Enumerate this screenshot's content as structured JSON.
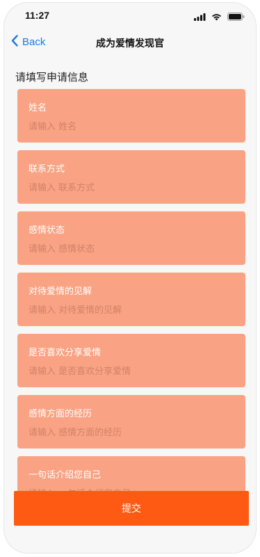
{
  "status_bar": {
    "time": "11:27"
  },
  "nav": {
    "back_label": "Back",
    "title": "成为爱情发现官"
  },
  "section_title": "请填写申请信息",
  "fields": [
    {
      "label": "姓名",
      "placeholder": "请输入 姓名"
    },
    {
      "label": "联系方式",
      "placeholder": "请输入 联系方式"
    },
    {
      "label": "感情状态",
      "placeholder": "请输入 感情状态"
    },
    {
      "label": "对待爱情的见解",
      "placeholder": "请输入 对待爱情的见解"
    },
    {
      "label": "是否喜欢分享爱情",
      "placeholder": "请输入 是否喜欢分享爱情"
    },
    {
      "label": "感情方面的经历",
      "placeholder": "请输入 感情方面的经历"
    },
    {
      "label": "一句话介绍您自己",
      "placeholder": "请输入 一句话介绍您自己"
    }
  ],
  "submit_label": "提交",
  "colors": {
    "card": "#f9a384",
    "submit": "#ff5a14",
    "back": "#1f7ae0"
  }
}
